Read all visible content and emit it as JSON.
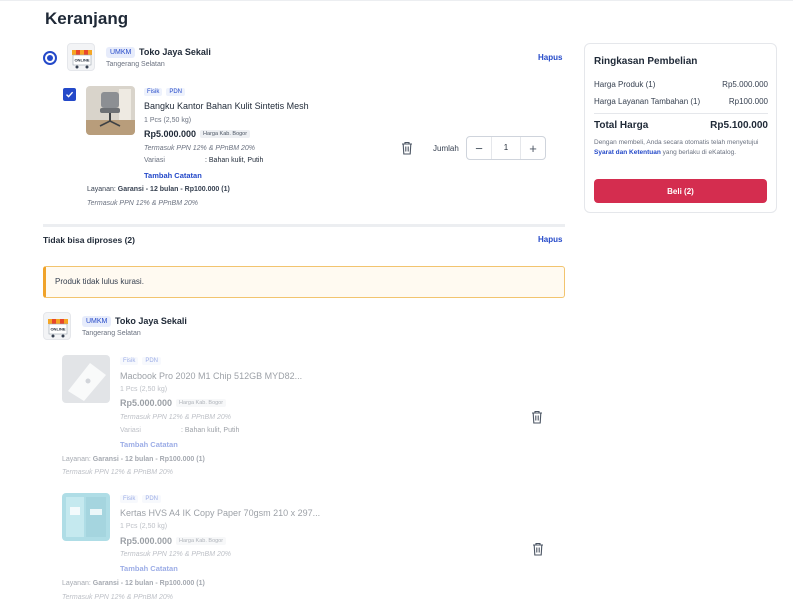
{
  "page": {
    "title": "Keranjang"
  },
  "cart": {
    "delete_label": "Hapus",
    "shop": {
      "badge": "UMKM",
      "name": "Toko Jaya Sekali",
      "location": "Tangerang Selatan",
      "logo_text": "ONLINE"
    },
    "item": {
      "tags": [
        "Fisik",
        "PDN"
      ],
      "name": "Bangku Kantor Bahan Kulit Sintetis Mesh",
      "qty_weight": "1 Pcs (2,50 kg)",
      "price": "Rp5.000.000",
      "price_tag": "Harga Kab. Bogor",
      "tax_note": "Termasuk PPN 12% & PPnBM 20%",
      "variant_label": "Variasi",
      "variant_value": ": Bahan kulit, Putih",
      "note_link": "Tambah Catatan",
      "quantity_label": "Jumlah",
      "quantity": "1",
      "service_label": "Layanan:",
      "service_value": "Garansi - 12 bulan - Rp100.000 (1)",
      "service_tax": "Termasuk PPN 12% & PPnBM 20%"
    }
  },
  "unprocessable": {
    "title": "Tidak bisa diproses (2)",
    "delete_label": "Hapus",
    "alert": "Produk tidak lulus kurasi.",
    "shop": {
      "badge": "UMKM",
      "name": "Toko Jaya Sekali",
      "location": "Tangerang Selatan",
      "logo_text": "ONLINE"
    },
    "items": [
      {
        "tags": [
          "Fisik",
          "PDN"
        ],
        "name": "Macbook Pro 2020 M1 Chip 512GB MYD82...",
        "qty_weight": "1 Pcs (2,50 kg)",
        "price": "Rp5.000.000",
        "price_tag": "Harga Kab. Bogor",
        "tax_note": "Termasuk PPN 12% & PPnBM 20%",
        "variant_label": "Variasi",
        "variant_value": ": Bahan kulit, Putih",
        "note_link": "Tambah Catatan",
        "service_label": "Layanan:",
        "service_value": "Garansi - 12 bulan - Rp100.000 (1)",
        "service_tax": "Termasuk PPN 12% & PPnBM 20%"
      },
      {
        "tags": [
          "Fisik",
          "PDN"
        ],
        "name": "Kertas HVS A4 IK Copy Paper 70gsm 210 x 297...",
        "qty_weight": "1 Pcs (2,50 kg)",
        "price": "Rp5.000.000",
        "price_tag": "Harga Kab. Bogor",
        "tax_note": "Termasuk PPN 12% & PPnBM 20%",
        "note_link": "Tambah Catatan",
        "service_label": "Layanan:",
        "service_value": "Garansi - 12 bulan - Rp100.000 (1)",
        "service_tax": "Termasuk PPN 12% & PPnBM 20%"
      }
    ]
  },
  "summary": {
    "title": "Ringkasan Pembelian",
    "rows": [
      {
        "label": "Harga Produk (1)",
        "value": "Rp5.000.000"
      },
      {
        "label": "Harga Layanan Tambahan (1)",
        "value": "Rp100.000"
      }
    ],
    "total_label": "Total Harga",
    "total_value": "Rp5.100.000",
    "note_before": "Dengan membeli, Anda secara otomatis telah menyetujui",
    "note_link": "Syarat dan Ketentuan",
    "note_after": "yang berlaku di eKatalog.",
    "buy_label": "Beli (2)"
  },
  "colors": {
    "primary": "#2449c9",
    "buy": "#d42d4f",
    "alert_border": "#f0a32a"
  }
}
